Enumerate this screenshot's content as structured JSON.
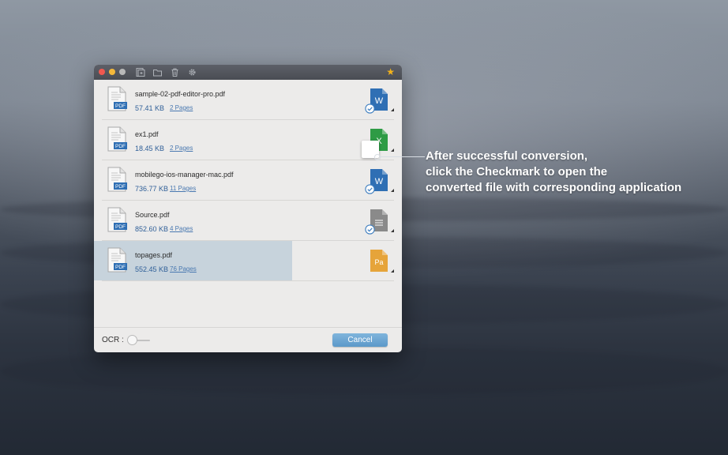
{
  "window": {
    "toolbar": {
      "icons": [
        "add-file-icon",
        "folder-icon",
        "trash-icon",
        "gear-icon",
        "star-icon"
      ]
    },
    "files": [
      {
        "name": "sample-02-pdf-editor-pro.pdf",
        "size": "57.41 KB",
        "pages": "2 Pages",
        "format": "W",
        "format_color": "#2f6fb4",
        "converted": true,
        "selected": false
      },
      {
        "name": "ex1.pdf",
        "size": "18.45 KB",
        "pages": "2 Pages",
        "format": "X",
        "format_color": "#2e9b45",
        "converted": true,
        "selected": false
      },
      {
        "name": "mobilego-ios-manager-mac.pdf",
        "size": "736.77 KB",
        "pages": "11 Pages",
        "format": "W",
        "format_color": "#2f6fb4",
        "converted": true,
        "selected": false
      },
      {
        "name": "Source.pdf",
        "size": "852.60 KB",
        "pages": "4 Pages",
        "format": "",
        "format_color": "#8a8a8a",
        "converted": true,
        "selected": false
      },
      {
        "name": "topages.pdf",
        "size": "552.45 KB",
        "pages": "76 Pages",
        "format": "Pa",
        "format_color": "#e6a43a",
        "converted": false,
        "selected": true
      }
    ],
    "pdf_badge": "PDF",
    "ocr_label": "OCR :",
    "cancel_label": "Cancel"
  },
  "callout": {
    "line1": "After successful conversion,",
    "line2": "click the Checkmark to open the",
    "line3": "converted file with corresponding application"
  },
  "colors": {
    "accent": "#5c99c9",
    "link": "#4a79b1",
    "selection": "#c7d3dc"
  }
}
